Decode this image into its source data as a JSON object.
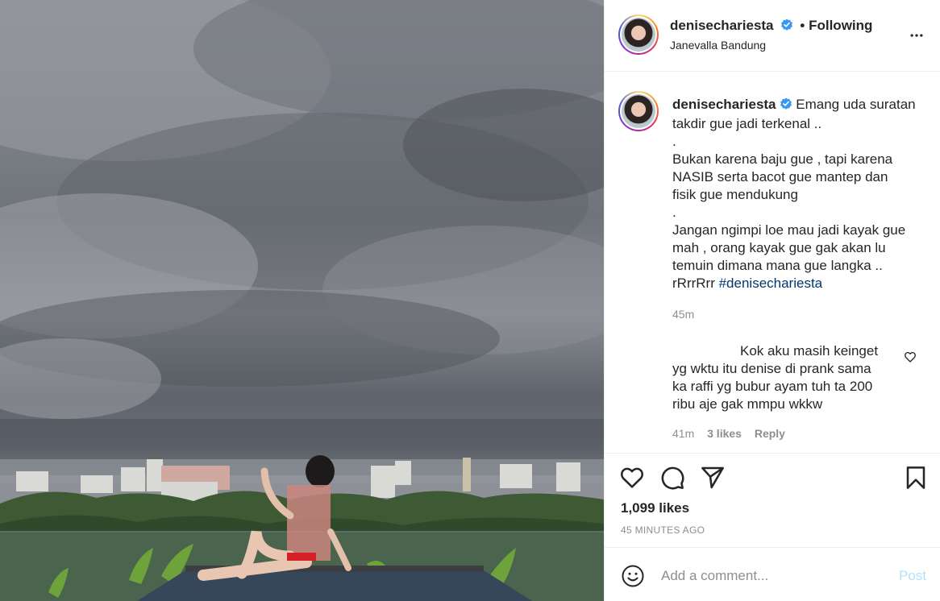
{
  "post": {
    "username": "denisechariesta",
    "follow_status": "• Following",
    "location": "Janevalla Bandung"
  },
  "caption": {
    "username": "denisechariesta",
    "lines": [
      "Emang uda suratan",
      "takdir gue jadi terkenal ..",
      ".",
      "Bukan karena baju gue , tapi karena",
      "NASIB serta bacot gue mantep dan",
      "fisik gue mendukung",
      ".",
      "Jangan ngimpi loe mau jadi kayak gue",
      "mah , orang kayak gue gak akan lu",
      "temuin dimana mana gue langka .."
    ],
    "last_line_prefix": "rRrrRrr",
    "hashtag": "#denisechariesta",
    "time": "45m"
  },
  "reply": {
    "lines": [
      "Kok aku masih keinget",
      "yg wktu itu denise di prank sama",
      "ka raffi yg bubur ayam tuh ta 200",
      "ribu aje gak mmpu wkkw"
    ],
    "time": "41m",
    "likes": "3 likes",
    "reply_label": "Reply"
  },
  "actions": {
    "like_count": "1,099 likes",
    "posted_ago": "45 MINUTES AGO"
  },
  "composer": {
    "placeholder": "Add a comment...",
    "post_label": "Post"
  },
  "icons": {
    "header_more": "more-horizontal-icon",
    "verified": "verified-badge-icon",
    "like": "heart-icon",
    "comment": "comment-bubble-icon",
    "share": "paper-plane-icon",
    "save": "bookmark-icon",
    "emoji": "smiley-icon"
  },
  "colors": {
    "verified_blue": "#3897f0",
    "hashtag": "#00376b",
    "muted": "#8e8e8e",
    "post_disabled": "#b2dffc"
  }
}
